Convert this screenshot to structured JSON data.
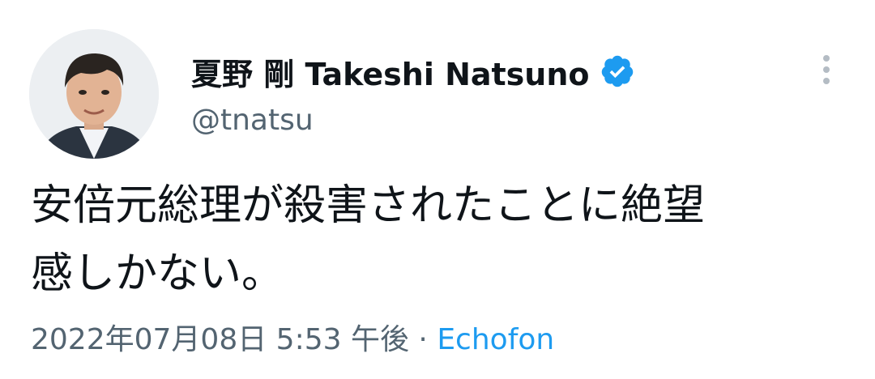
{
  "tweet": {
    "author": {
      "display_name": "夏野 剛 Takeshi Natsuno",
      "handle": "@tnatsu",
      "verified": true,
      "verified_icon": "verified-badge-icon"
    },
    "text_lines": [
      "安倍元総理が殺害されたことに絶望",
      "感しかない。"
    ],
    "timestamp": "2022年07月08日 5:53 午後",
    "separator": " · ",
    "source": "Echofon",
    "more_icon": "more-vertical-icon"
  },
  "colors": {
    "text_primary": "#0f1419",
    "text_secondary": "#536471",
    "link": "#1d9bf0",
    "verified": "#1d9bf0"
  }
}
